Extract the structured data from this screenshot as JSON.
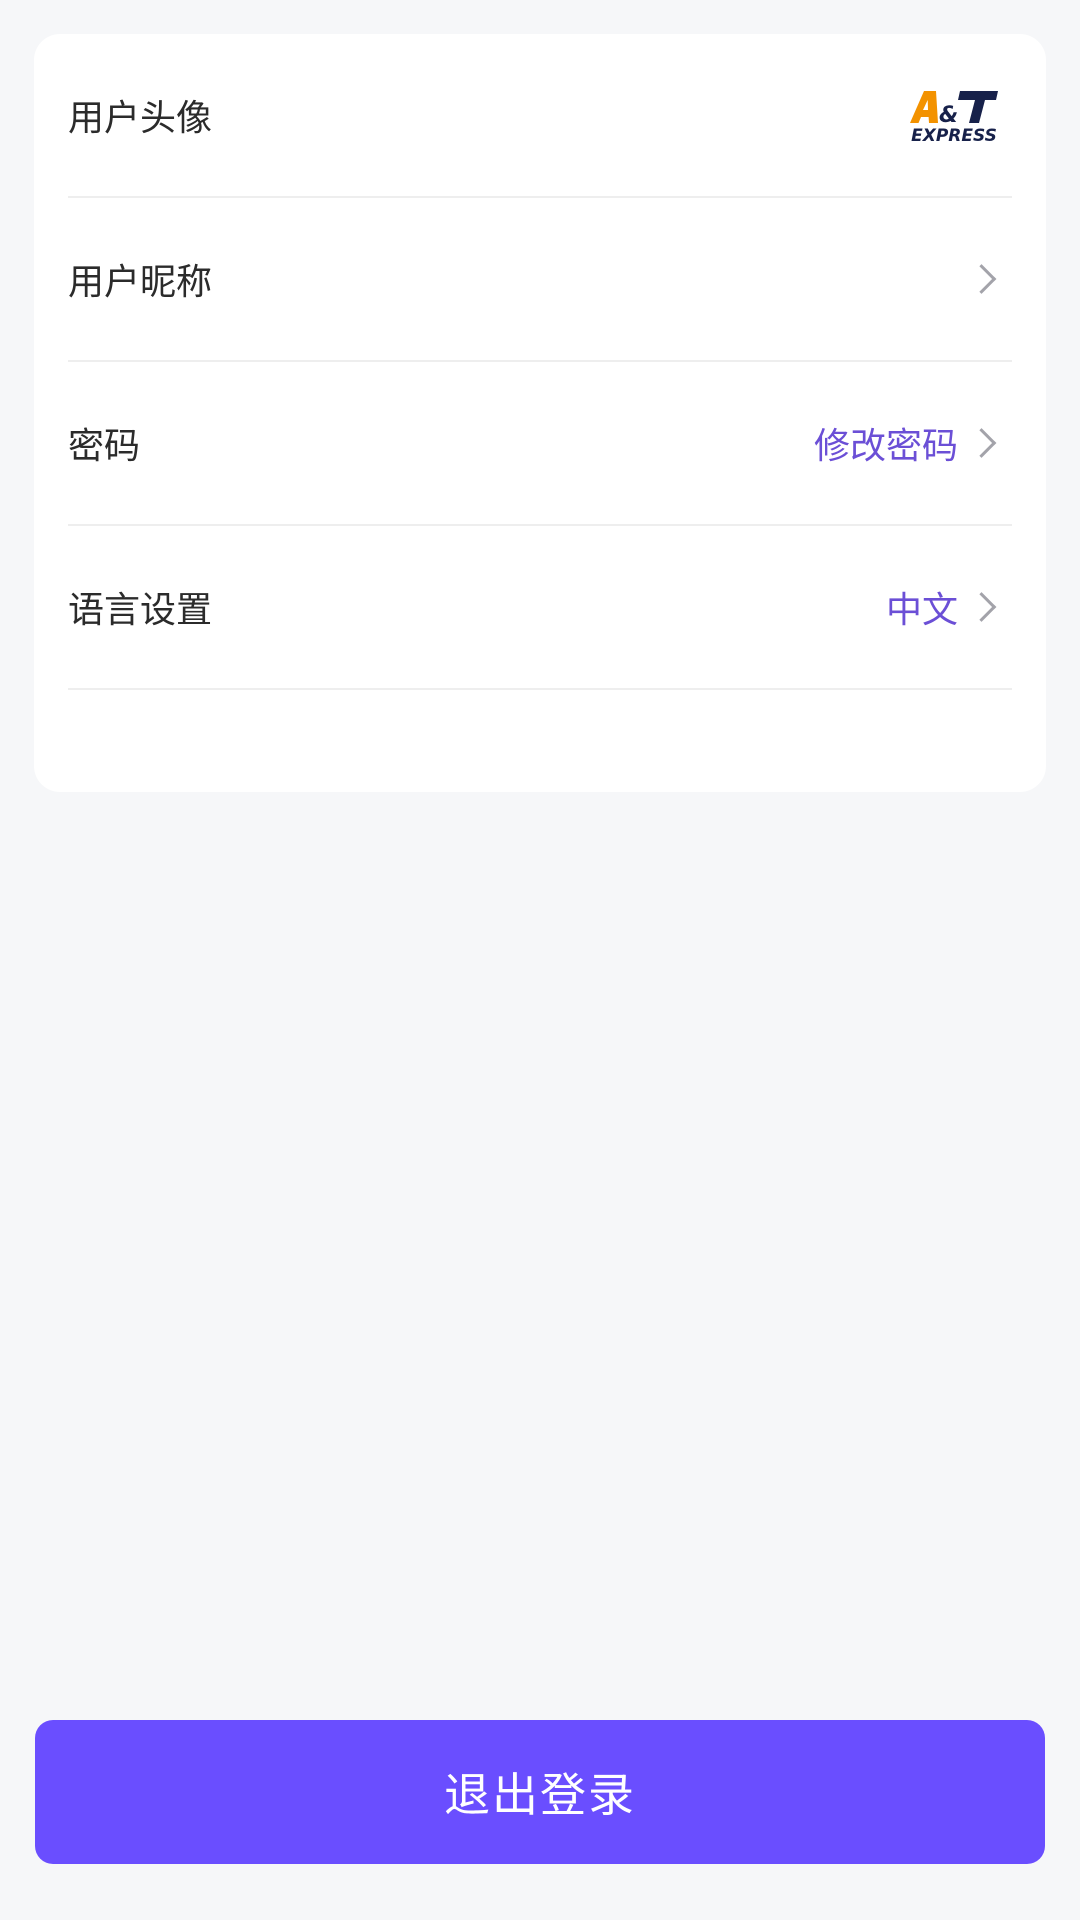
{
  "settings": {
    "rows": [
      {
        "label": "用户头像",
        "value": "",
        "icon": "avatar-logo"
      },
      {
        "label": "用户昵称",
        "value": "",
        "icon": "chevron-right-icon"
      },
      {
        "label": "密码",
        "value": "修改密码",
        "icon": "chevron-right-icon"
      },
      {
        "label": "语言设置",
        "value": "中文",
        "icon": "chevron-right-icon"
      }
    ]
  },
  "avatar_logo": {
    "line1": "A&T",
    "line2": "EXPRESS"
  },
  "colors": {
    "background": "#f6f7f9",
    "card": "#ffffff",
    "accent": "#6a4eff",
    "value_text": "#6b4fd6",
    "logo_orange": "#f39200",
    "logo_navy": "#17214a"
  },
  "logout": {
    "label": "退出登录"
  }
}
